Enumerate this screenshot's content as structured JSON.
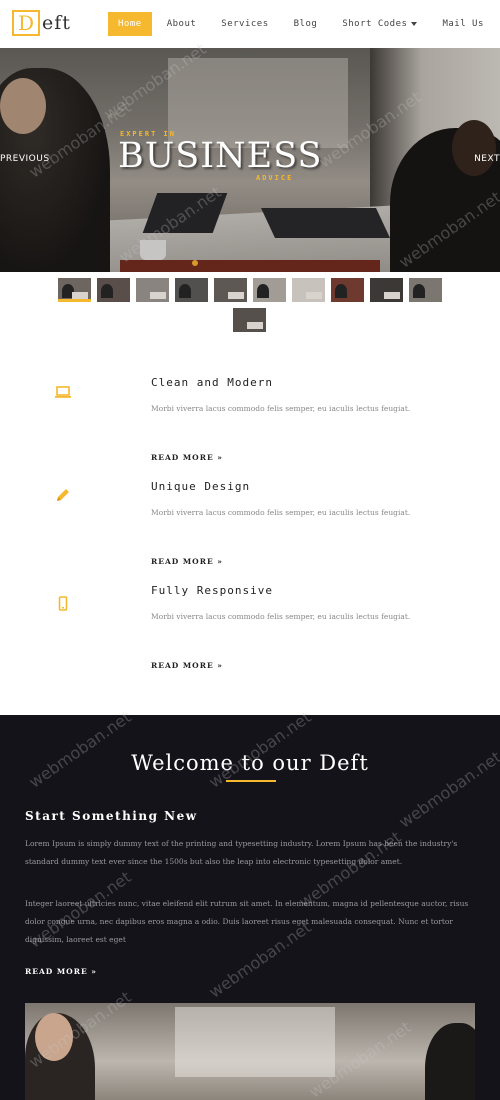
{
  "brand": {
    "initial": "D",
    "rest": "eft",
    "accent": "#f5b82e"
  },
  "nav": {
    "items": [
      {
        "label": "Home",
        "active": true
      },
      {
        "label": "About"
      },
      {
        "label": "Services"
      },
      {
        "label": "Blog"
      },
      {
        "label": "Short Codes",
        "has_dropdown": true
      },
      {
        "label": "Mail Us"
      }
    ]
  },
  "hero": {
    "kicker": "EXPERT IN",
    "title": "BUSINESS",
    "subtitle": "ADVICE",
    "prev_label": "PREVIOUS",
    "next_label": "NEXT"
  },
  "thumbnails": {
    "count": 11,
    "active_index": 0
  },
  "features": [
    {
      "icon": "laptop-icon",
      "title": "Clean and Modern",
      "desc": "Morbi viverra lacus commodo felis semper, eu iaculis lectus feugiat.",
      "more": "READ MORE »"
    },
    {
      "icon": "pencil-icon",
      "title": "Unique Design",
      "desc": "Morbi viverra lacus commodo felis semper, eu iaculis lectus feugiat.",
      "more": "READ MORE »"
    },
    {
      "icon": "mobile-icon",
      "title": "Fully Responsive",
      "desc": "Morbi viverra lacus commodo felis semper, eu iaculis lectus feugiat.",
      "more": "READ MORE »"
    }
  ],
  "welcome": {
    "title": "Welcome to our Deft",
    "subtitle": "Start Something New",
    "p1": "Lorem Ipsum is simply dummy text of the printing and typesetting industry. Lorem Ipsum has been the industry's standard dummy text ever since the 1500s but also the leap into electronic typesetting dolor amet.",
    "p2": "Integer laoreet ultricies nunc, vitae eleifend elit rutrum sit amet. In elementum, magna id pellentesque auctor, risus dolor congue urna, nec dapibus eros magna a odio. Duis laoreet risus eget malesuada consequat. Nunc et tortor dignissim, laoreet est eget",
    "more": "READ MORE »"
  },
  "watermark": "webmoban.net"
}
